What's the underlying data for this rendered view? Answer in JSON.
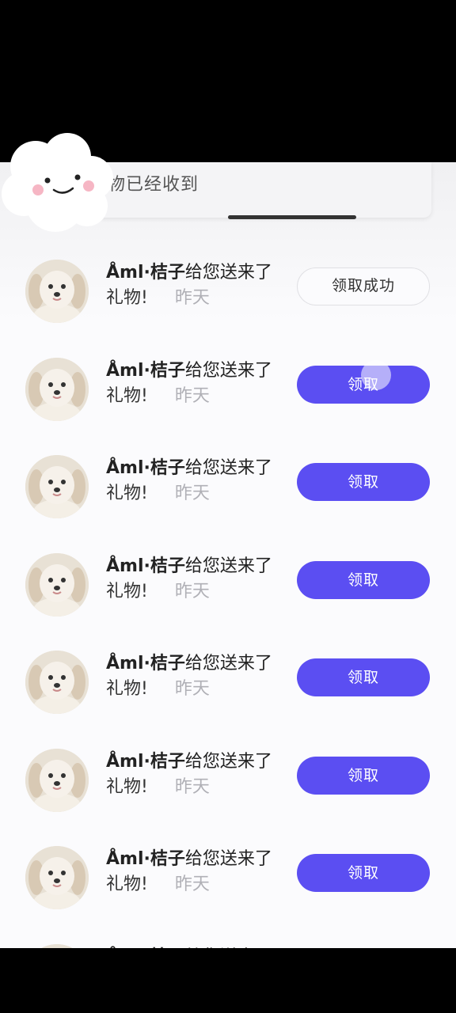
{
  "toast": {
    "text": "物已经收到"
  },
  "rows": [
    {
      "name": "Åml·桔子",
      "text": "给您送来了",
      "text2": "礼物!",
      "time": "昨天",
      "button": "领取成功",
      "claimed": true
    },
    {
      "name": "Åml·桔子",
      "text": "给您送来了",
      "text2": "礼物!",
      "time": "昨天",
      "button": "领取",
      "claimed": false
    },
    {
      "name": "Åml·桔子",
      "text": "给您送来了",
      "text2": "礼物!",
      "time": "昨天",
      "button": "领取",
      "claimed": false
    },
    {
      "name": "Åml·桔子",
      "text": "给您送来了",
      "text2": "礼物!",
      "time": "昨天",
      "button": "领取",
      "claimed": false
    },
    {
      "name": "Åml·桔子",
      "text": "给您送来了",
      "text2": "礼物!",
      "time": "昨天",
      "button": "领取",
      "claimed": false
    },
    {
      "name": "Åml·桔子",
      "text": "给您送来了",
      "text2": "礼物!",
      "time": "昨天",
      "button": "领取",
      "claimed": false
    },
    {
      "name": "Åml·桔子",
      "text": "给您送来了",
      "text2": "礼物!",
      "time": "昨天",
      "button": "领取",
      "claimed": false
    },
    {
      "name": "Åml·桔子",
      "text": "给您送来了",
      "text2": "",
      "time": "",
      "button": "",
      "claimed": false
    }
  ],
  "colors": {
    "accent": "#5b4ef2",
    "background": "#fbfbfd",
    "muted_text": "#b0b0b6"
  },
  "icons": {
    "avatar": "puppy-avatar-icon",
    "sticker": "cloud-face-sticker-icon"
  }
}
